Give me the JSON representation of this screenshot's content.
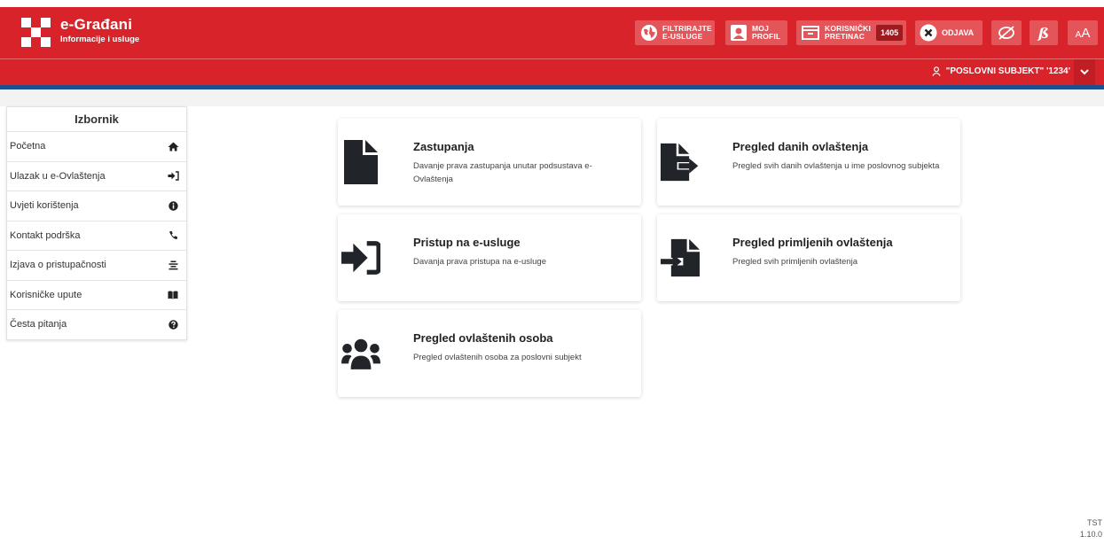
{
  "header": {
    "app_title": "e-Građani",
    "app_subtitle": "Informacije i usluge",
    "filter_line1": "FILTRIRAJTE",
    "filter_line2": "E-USLUGE",
    "profile_line1": "MOJ",
    "profile_line2": "PROFIL",
    "inbox_line1": "KORISNIČKI",
    "inbox_line2": "PRETINAC",
    "inbox_count": "1405",
    "logout_label": "ODJAVA",
    "font_size_label": "AA",
    "brand_color": "#d8232a"
  },
  "subject_bar": {
    "subject_label": "\"POSLOVNI SUBJEKT\" '1234'"
  },
  "sidebar": {
    "title": "Izbornik",
    "items": [
      {
        "label": "Početna",
        "icon": "home-icon"
      },
      {
        "label": "Ulazak u e-Ovlaštenja",
        "icon": "sign-in-icon"
      },
      {
        "label": "Uvjeti korištenja",
        "icon": "info-circle-icon"
      },
      {
        "label": "Kontakt podrška",
        "icon": "phone-icon"
      },
      {
        "label": "Izjava o pristupačnosti",
        "icon": "align-center-icon"
      },
      {
        "label": "Korisničke upute",
        "icon": "book-icon"
      },
      {
        "label": "Česta pitanja",
        "icon": "question-circle-icon"
      }
    ]
  },
  "cards": [
    {
      "title": "Zastupanja",
      "description": "Davanje prava zastupanja unutar podsustava e-Ovlaštenja",
      "icon": "file-icon"
    },
    {
      "title": "Pregled danih ovlaštenja",
      "description": "Pregled svih danih ovlaštenja u ime poslovnog subjekta",
      "icon": "file-export-icon"
    },
    {
      "title": "Pristup na e-usluge",
      "description": "Davanja prava pristupa na e-usluge",
      "icon": "sign-in-icon"
    },
    {
      "title": "Pregled primljenih ovlaštenja",
      "description": "Pregled svih primljenih ovlaštenja",
      "icon": "file-import-icon"
    },
    {
      "title": "Pregled ovlaštenih osoba",
      "description": "Pregled ovlaštenih osoba za poslovni subjekt",
      "icon": "users-icon"
    }
  ],
  "footer": {
    "env": "TST",
    "version": "1.10.0"
  }
}
